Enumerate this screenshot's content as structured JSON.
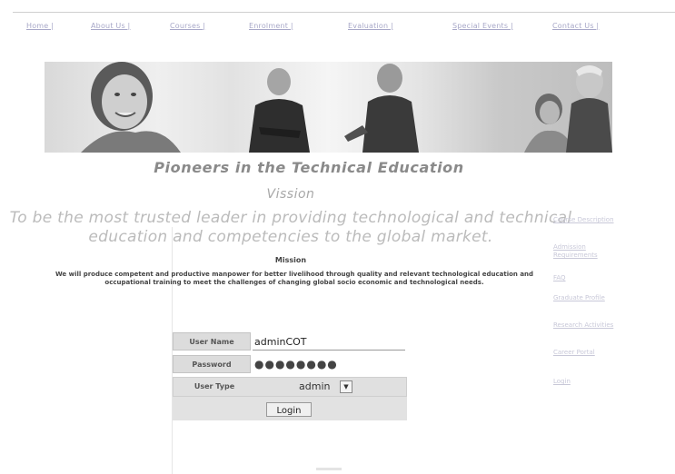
{
  "nav": {
    "items": [
      {
        "label": "Home |"
      },
      {
        "label": "About Us |"
      },
      {
        "label": "Courses |"
      },
      {
        "label": "Enrolment |"
      },
      {
        "label": "Evaluation |"
      },
      {
        "label": "Special Events |"
      },
      {
        "label": "Contact Us |"
      }
    ]
  },
  "banner": {
    "subject_icons": [
      "smiling-woman-headset",
      "businessman-arms-crossed",
      "man-presenting",
      "woman-listening",
      "senior-businessman"
    ]
  },
  "headline": {
    "tagline": "Pioneers in the Technical Education",
    "vision_title": "Vission",
    "vision_text": "To be the most trusted leader in providing technological and technical education and competencies to the global market."
  },
  "mission": {
    "title": "Mission",
    "text": "We will produce competent and productive manpower for better livelihood through quality and relevant technological education and occupational training to meet the challenges of changing global socio economic and technological needs."
  },
  "sidebar": {
    "links": [
      {
        "label": "Course Description"
      },
      {
        "label": "Admission Requirements"
      },
      {
        "label": "FAQ"
      },
      {
        "label": "Graduate Profile"
      },
      {
        "label": "Research Activities"
      },
      {
        "label": "Career Portal"
      },
      {
        "label": "Login"
      }
    ]
  },
  "login": {
    "username_label": "User Name",
    "username_value": "adminCOT",
    "password_label": "Password",
    "password_value": "●●●●●●●●",
    "usertype_label": "User Type",
    "usertype_value": "admin",
    "button_label": "Login"
  },
  "colors": {
    "nav_link": "#a8a8c8",
    "label_bg": "#dcdcdc",
    "headline": "#8a8a8a"
  }
}
